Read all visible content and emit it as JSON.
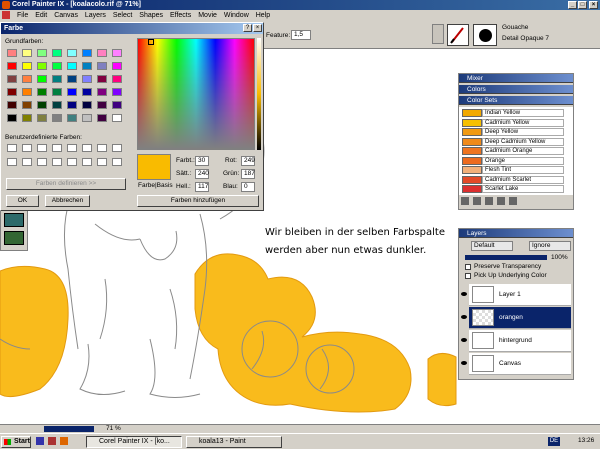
{
  "window": {
    "title": "Corel Painter IX - [koalacolo.rif @ 71%]"
  },
  "menu": [
    "File",
    "Edit",
    "Canvas",
    "Layers",
    "Select",
    "Shapes",
    "Effects",
    "Movie",
    "Window",
    "Help"
  ],
  "propbar": {
    "feature_label": "Feature:",
    "feature_value": "1,5",
    "brush_category": "Gouache",
    "brush_variant": "Detail Opaque 7"
  },
  "dialog": {
    "title": "Farbe",
    "basic_colors_label": "Grundfarben:",
    "custom_colors_label": "Benutzerdefinierte Farben:",
    "define_button": "Farben definieren >>",
    "ok_button": "OK",
    "cancel_button": "Abbrechen",
    "add_button": "Farben hinzufügen",
    "swatch_label": "Farbe|Basis",
    "hue_label": "Farbt.:",
    "hue": "30",
    "sat_label": "Sätt.:",
    "sat": "240",
    "lum_label": "Hell.:",
    "lum": "117",
    "red_label": "Rot:",
    "red": "249",
    "green_label": "Grün:",
    "green": "187",
    "blue_label": "Blau:",
    "blue": "0",
    "selected_color": "#f9bb00",
    "basic_colors": [
      "#ff8080",
      "#ffff80",
      "#80ff80",
      "#00ff80",
      "#80ffff",
      "#0080ff",
      "#ff80c0",
      "#ff80ff",
      "#ff0000",
      "#ffff00",
      "#80ff00",
      "#00ff40",
      "#00ffff",
      "#0080c0",
      "#8080c0",
      "#ff00ff",
      "#804040",
      "#ff8040",
      "#00ff00",
      "#008080",
      "#004080",
      "#8080ff",
      "#800040",
      "#ff0080",
      "#800000",
      "#ff8000",
      "#008000",
      "#008040",
      "#0000ff",
      "#0000a0",
      "#800080",
      "#8000ff",
      "#400000",
      "#804000",
      "#004000",
      "#004040",
      "#000080",
      "#000040",
      "#400040",
      "#400080",
      "#000000",
      "#808000",
      "#808040",
      "#808080",
      "#408080",
      "#c0c0c0",
      "#400040",
      "#ffffff"
    ]
  },
  "panels": {
    "mixer": "Mixer",
    "colors": "Colors",
    "color_sets": "Color Sets",
    "color_set_items": [
      {
        "name": "Indian Yellow",
        "color": "#f2a900"
      },
      {
        "name": "Cadmium Yellow",
        "color": "#f6c000"
      },
      {
        "name": "Deep Yellow",
        "color": "#f19a12"
      },
      {
        "name": "Deep Cadmium Yellow",
        "color": "#f08a1a"
      },
      {
        "name": "Cadmium Orange",
        "color": "#ee7420"
      },
      {
        "name": "Orange",
        "color": "#ec6a1e"
      },
      {
        "name": "Flesh Tint",
        "color": "#f2b07a"
      },
      {
        "name": "Cadmium Scarlet",
        "color": "#e34a28"
      },
      {
        "name": "Scarlet Lake",
        "color": "#dc2f2f"
      }
    ],
    "layers_title": "Layers",
    "composite_method": "Default",
    "composite_depth": "Ignore",
    "opacity": "100%",
    "preserve_transparency": "Preserve Transparency",
    "pick_up_color": "Pick Up Underlying Color",
    "layers": [
      "Layer 1",
      "orangen",
      "hintergrund",
      "Canvas"
    ]
  },
  "canvas": {
    "caption_line1": "Wir bleiben in der selben  Farbspalte",
    "caption_line2": "werden aber nun etwas dunkler."
  },
  "status": {
    "zoom": "71 %"
  },
  "taskbar": {
    "start": "Start",
    "task1": "Corel Painter IX - [ko...",
    "task2": "koala13 - Paint",
    "lang": "DE",
    "clock": "13:26"
  }
}
